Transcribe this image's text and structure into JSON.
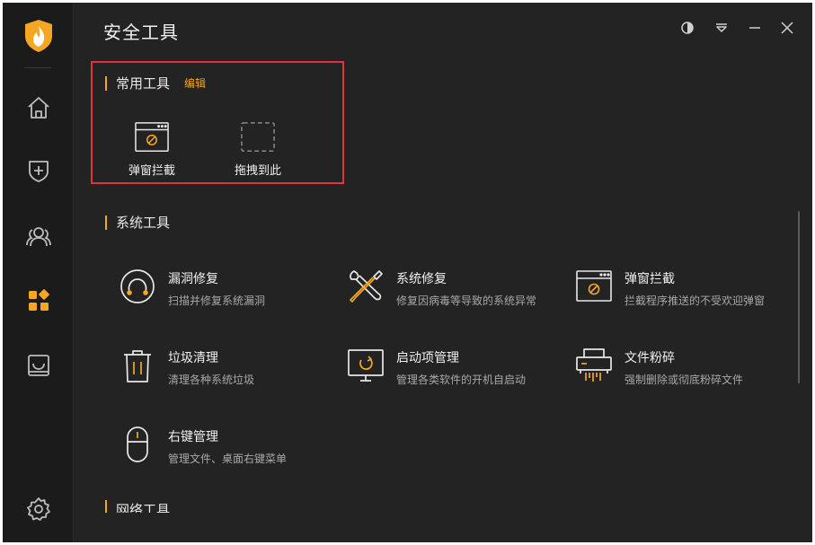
{
  "app": {
    "title": "安全工具"
  },
  "colors": {
    "accent": "#f5a623",
    "highlight": "#e0333a",
    "background": "#232323",
    "sidebar": "#1b1b1b"
  },
  "sidebar": {
    "items": [
      {
        "name": "home",
        "icon": "home-icon"
      },
      {
        "name": "protection",
        "icon": "shield-plus-icon"
      },
      {
        "name": "users",
        "icon": "users-icon"
      },
      {
        "name": "tools",
        "icon": "apps-icon",
        "active": true
      },
      {
        "name": "box",
        "icon": "tray-icon"
      },
      {
        "name": "settings",
        "icon": "gear-icon"
      }
    ]
  },
  "titlebar": {
    "buttons": [
      "theme-icon",
      "dropdown-icon",
      "minimize-icon",
      "close-icon"
    ]
  },
  "common": {
    "title": "常用工具",
    "edit_label": "编辑",
    "items": [
      {
        "label": "弹窗拦截",
        "icon": "popup-block-icon"
      },
      {
        "label": "拖拽到此",
        "icon": "drop-placeholder-icon"
      }
    ]
  },
  "system": {
    "title": "系统工具",
    "items": [
      {
        "name": "漏洞修复",
        "desc": "扫描并修复系统漏洞",
        "icon": "vulnerability-fix-icon"
      },
      {
        "name": "系统修复",
        "desc": "修复因病毒等导致的系统异常",
        "icon": "wrench-screwdriver-icon"
      },
      {
        "name": "弹窗拦截",
        "desc": "拦截程序推送的不受欢迎弹窗",
        "icon": "popup-block-icon"
      },
      {
        "name": "垃圾清理",
        "desc": "清理各种系统垃圾",
        "icon": "trash-icon"
      },
      {
        "name": "启动项管理",
        "desc": "管理各类软件的开机自启动",
        "icon": "monitor-startup-icon"
      },
      {
        "name": "文件粉碎",
        "desc": "强制删除或彻底粉碎文件",
        "icon": "shredder-icon"
      },
      {
        "name": "右键管理",
        "desc": "管理文件、桌面右键菜单",
        "icon": "mouse-icon"
      }
    ]
  },
  "network": {
    "title": "网络工具"
  }
}
